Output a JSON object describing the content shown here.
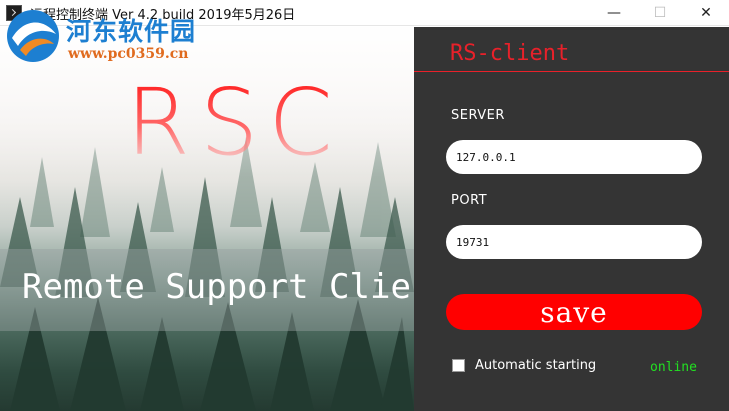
{
  "window": {
    "title": "远程控制终端 Ver 4.2 build 2019年5月26日",
    "minimize_glyph": "—",
    "maximize_glyph": "☐",
    "close_glyph": "✕"
  },
  "watermark": {
    "name": "河东软件园",
    "url": "www.pc0359.cn"
  },
  "hero": {
    "logo_text": "RSC",
    "caption": "Remote Support Client"
  },
  "panel": {
    "title": "RS-client",
    "server_label": "SERVER",
    "server_value": "127.0.0.1",
    "port_label": "PORT",
    "port_value": "19731",
    "save_label": "save",
    "auto_start_label": "Automatic starting",
    "auto_start_checked": false,
    "status_text": "online"
  },
  "colors": {
    "accent": "#e8212a",
    "save_button": "#ff0000",
    "panel_bg": "#343434",
    "status_online": "#22e022"
  },
  "icons": {
    "app": "terminal-icon",
    "watermark_logo": "watermark-logo-icon"
  }
}
